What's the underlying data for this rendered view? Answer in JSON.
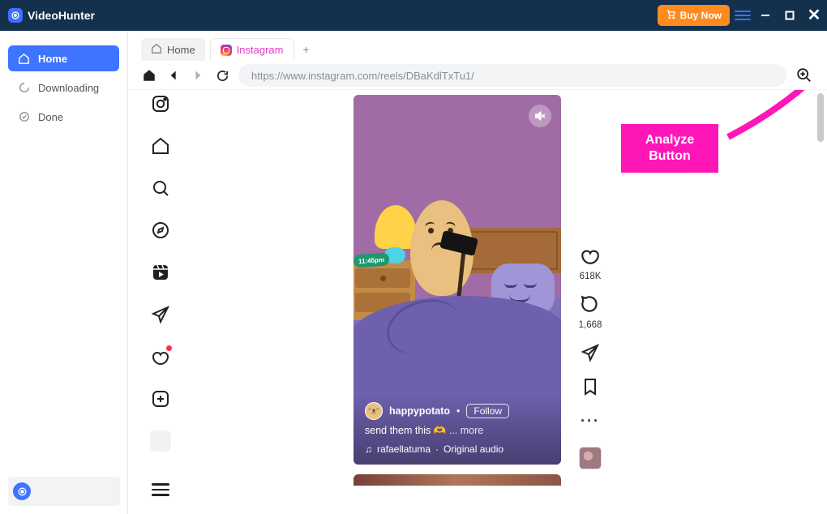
{
  "app": {
    "name": "VideoHunter",
    "buy_now_label": "Buy Now"
  },
  "sidebar": {
    "items": [
      {
        "label": "Home",
        "icon": "home-icon"
      },
      {
        "label": "Downloading",
        "icon": "spinner-icon"
      },
      {
        "label": "Done",
        "icon": "check-icon"
      }
    ]
  },
  "tabs": {
    "items": [
      {
        "label": "Home",
        "icon": "home-icon"
      },
      {
        "label": "Instagram",
        "icon": "instagram-icon"
      }
    ],
    "new_tab_glyph": "+"
  },
  "url": {
    "value": "https://www.instagram.com/reels/DBaKdlTxTu1/"
  },
  "ig_rail": {
    "icons": [
      "instagram-icon",
      "home-icon",
      "search-icon",
      "explore-icon",
      "reels-icon",
      "messages-icon",
      "notifications-icon",
      "create-icon",
      "profile-icon",
      "menu-icon"
    ]
  },
  "reel": {
    "username": "happypotato",
    "sep": "•",
    "follow_label": "Follow",
    "caption_text": "send them this 🫶",
    "more_label": "... more",
    "audio_artist": "rafaellatuma",
    "audio_sep": " · ",
    "audio_title": "Original audio",
    "clock_time": "11:45pm"
  },
  "actions": {
    "like_count": "618K",
    "comment_count": "1,668"
  },
  "callout": {
    "line1": "Analyze",
    "line2": "Button"
  }
}
